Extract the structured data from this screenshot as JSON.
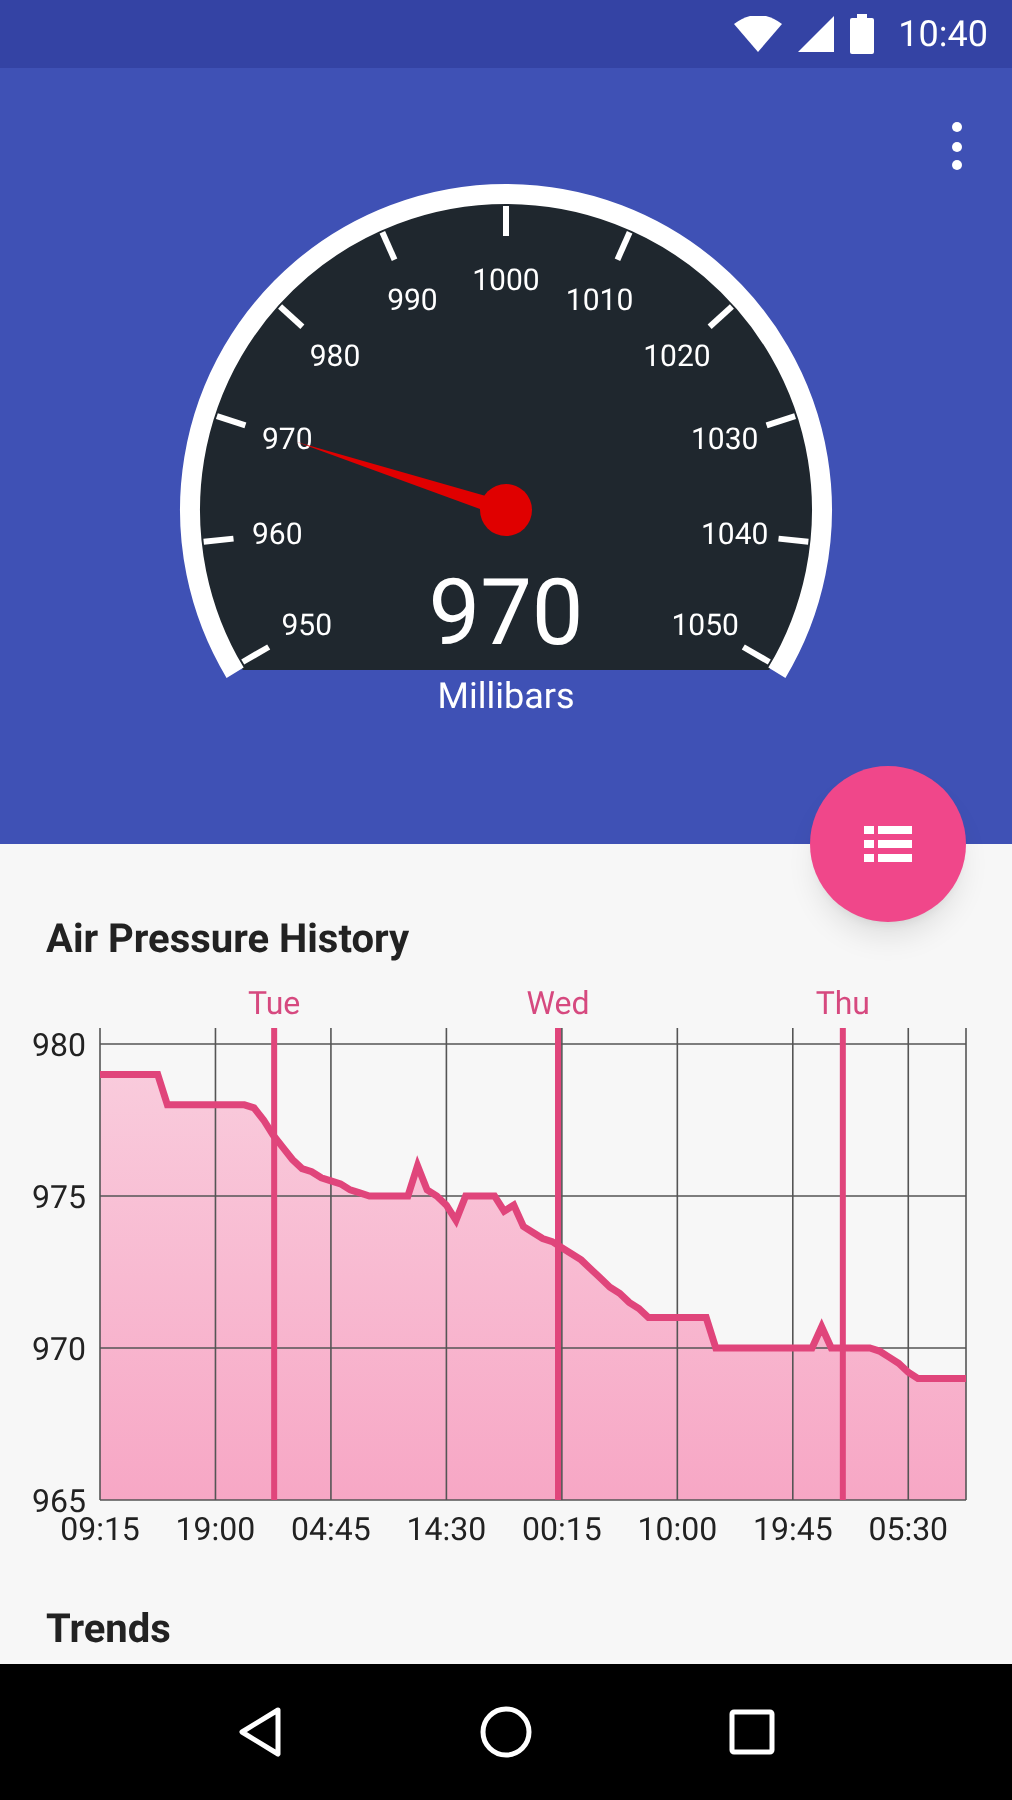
{
  "status_bar": {
    "time": "10:40"
  },
  "gauge": {
    "labels": [
      "950",
      "960",
      "970",
      "980",
      "990",
      "1000",
      "1010",
      "1020",
      "1030",
      "1040",
      "1050"
    ],
    "value": "970",
    "unit": "Millibars"
  },
  "history": {
    "chart_data": {
      "type": "area",
      "title": "Air Pressure History",
      "categories": [
        "09:15",
        null,
        null,
        null,
        null,
        null,
        null,
        null,
        null,
        null,
        null,
        null,
        "19:00",
        null,
        null,
        null,
        null,
        null,
        null,
        null,
        null,
        null,
        null,
        null,
        "04:45",
        null,
        null,
        null,
        null,
        null,
        null,
        null,
        null,
        null,
        null,
        null,
        "14:30",
        null,
        null,
        null,
        null,
        null,
        null,
        null,
        null,
        null,
        null,
        null,
        "00:15",
        null,
        null,
        null,
        null,
        null,
        null,
        null,
        null,
        null,
        null,
        null,
        "10:00",
        null,
        null,
        null,
        null,
        null,
        null,
        null,
        null,
        null,
        null,
        null,
        "19:45",
        null,
        null,
        null,
        null,
        null,
        null,
        null,
        null,
        null,
        null,
        null,
        "05:30",
        null,
        null,
        null,
        null,
        null,
        null
      ],
      "series": [
        {
          "color": "#e0457b",
          "values": [
            979,
            979,
            979,
            979,
            979,
            979,
            979,
            978,
            978,
            978,
            978,
            978,
            978,
            978,
            978,
            978,
            977.9,
            977.5,
            977,
            976.6,
            976.2,
            975.9,
            975.8,
            975.6,
            975.5,
            975.4,
            975.2,
            975.1,
            975,
            975,
            975,
            975,
            975,
            976,
            975.2,
            975,
            974.7,
            974.2,
            975,
            975,
            975,
            975,
            974.5,
            974.7,
            974,
            973.8,
            973.6,
            973.5,
            973.3,
            973.1,
            972.9,
            972.6,
            972.3,
            972,
            971.8,
            971.5,
            971.3,
            971,
            971,
            971,
            971,
            971,
            971,
            971,
            970,
            970,
            970,
            970,
            970,
            970,
            970,
            970,
            970,
            970,
            970,
            970.7,
            970,
            970,
            970,
            970,
            970,
            969.9,
            969.7,
            969.5,
            969.2,
            969,
            969,
            969,
            969,
            969,
            969
          ]
        }
      ],
      "ylim": [
        965,
        980
      ],
      "grid": true,
      "yticks": [
        965,
        970,
        975,
        980
      ],
      "annotations": [
        "Tue",
        "Wed",
        "Thu"
      ]
    }
  },
  "trends": {
    "title": "Trends"
  }
}
